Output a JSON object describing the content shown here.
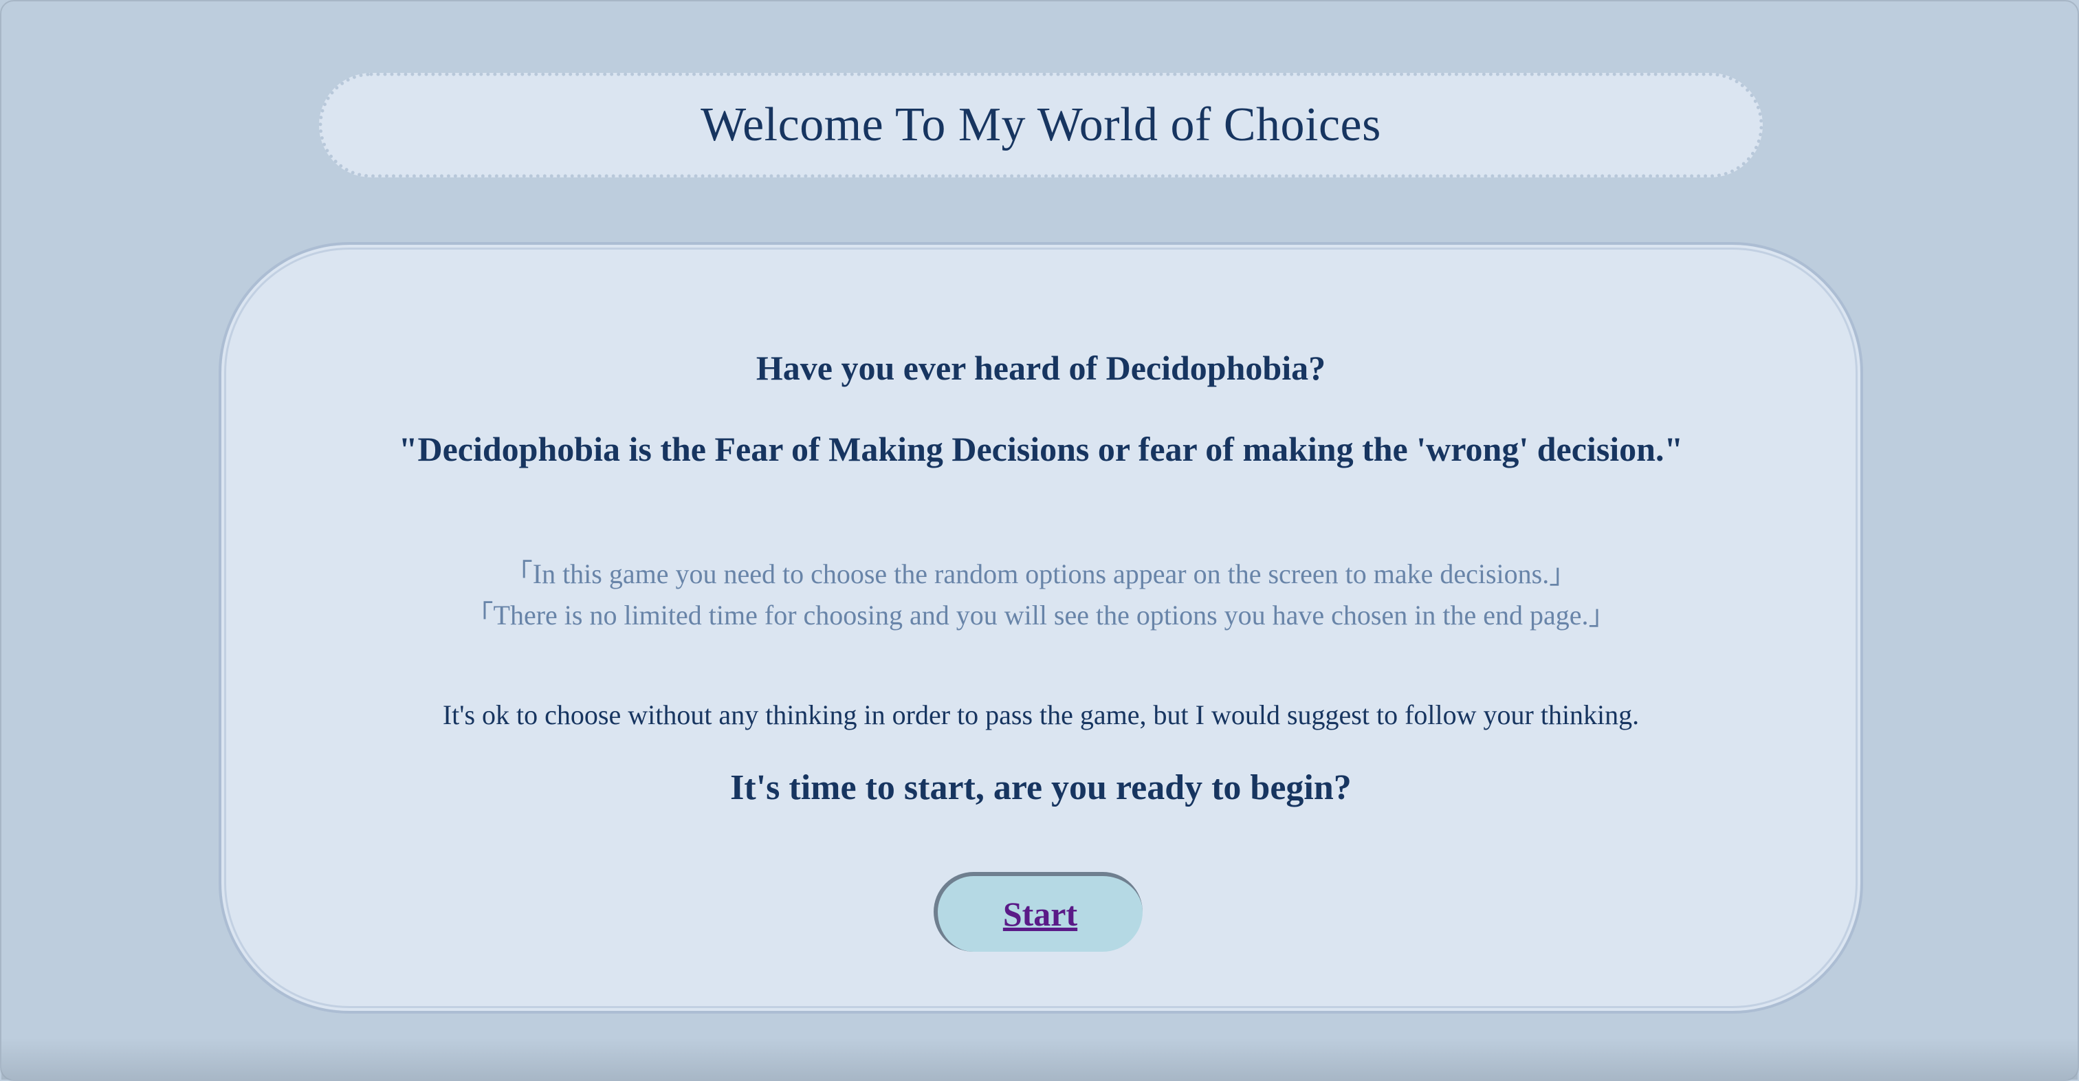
{
  "header": {
    "title": "Welcome To My World of Choices"
  },
  "intro": {
    "question": "Have you ever heard of Decidophobia?",
    "definition": "\"Decidophobia is the Fear of Making Decisions or fear of making the 'wrong' decision.\"",
    "rule_1": "「In this game you need to choose the random options appear on the screen to make decisions.」",
    "rule_2": "「There is no limited time for choosing and you will see the options you have chosen in the end page.」",
    "advice": "It's ok to choose without any thinking in order to pass the game, but I would suggest to follow your thinking.",
    "prompt": "It's time to start, are you ready to begin?"
  },
  "actions": {
    "start_label": "Start"
  },
  "colors": {
    "background": "#bdcddd",
    "card": "#dbe5f1",
    "heading_text": "#173560",
    "muted_text": "#6884a8",
    "button_bg": "#b5d9e4",
    "link_text": "#5a1a87"
  }
}
